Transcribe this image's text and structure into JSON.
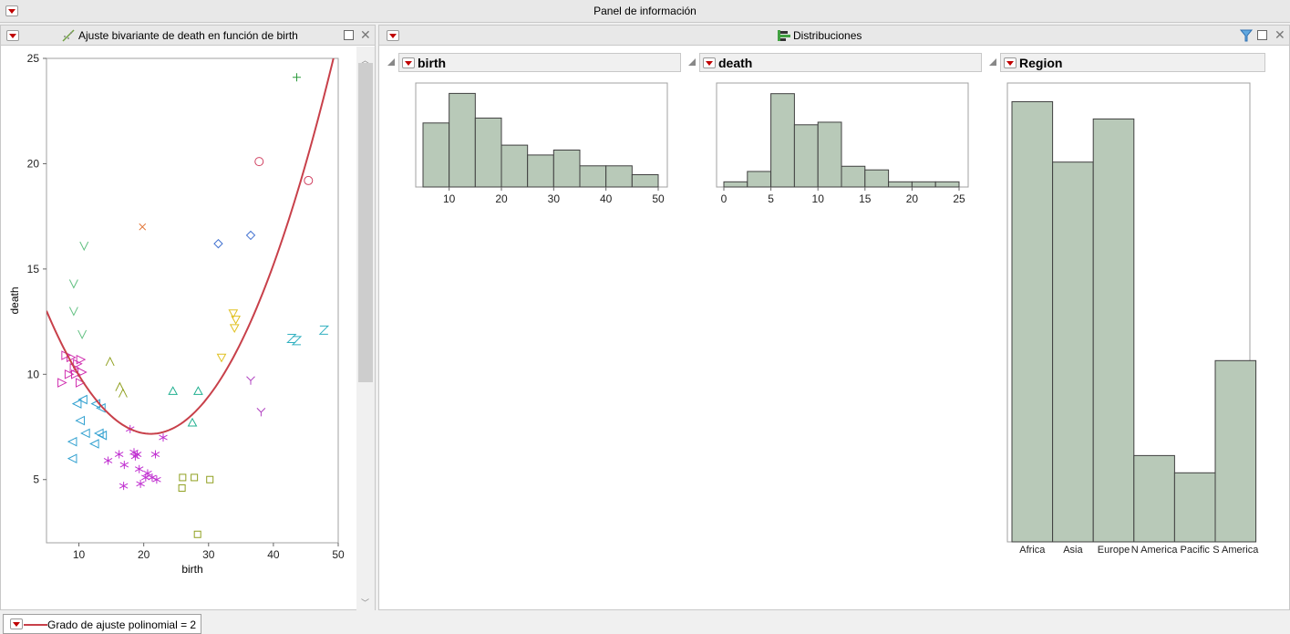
{
  "window": {
    "title": "Panel de información"
  },
  "bivariate": {
    "title": "Ajuste bivariante de death en función de birth",
    "xlabel": "birth",
    "ylabel": "death",
    "fit_label": "Grado de ajuste polinomial = 2"
  },
  "distributions": {
    "title": "Distribuciones",
    "birth": {
      "title": "birth"
    },
    "death": {
      "title": "death"
    },
    "region": {
      "title": "Region"
    }
  },
  "colors": {
    "bar_fill": "#b8c9b8",
    "bar_stroke": "#404040",
    "fit_line": "#c8404a",
    "button_red": "#c00000"
  },
  "chart_data": [
    {
      "type": "scatter",
      "xlabel": "birth",
      "ylabel": "death",
      "xlim": [
        5,
        50
      ],
      "ylim": [
        2,
        25
      ],
      "xticks": [
        10,
        20,
        30,
        40,
        50
      ],
      "yticks": [
        5,
        10,
        15,
        20,
        25
      ],
      "points": [
        {
          "x": 43.6,
          "y": 24.1,
          "m": "+",
          "c": "#2a9a3a"
        },
        {
          "x": 37.8,
          "y": 20.1,
          "m": "o",
          "c": "#d04060"
        },
        {
          "x": 45.4,
          "y": 19.2,
          "m": "o",
          "c": "#d04060"
        },
        {
          "x": 19.8,
          "y": 17.0,
          "m": "x",
          "c": "#e07030"
        },
        {
          "x": 31.5,
          "y": 16.2,
          "m": "d",
          "c": "#4070d0"
        },
        {
          "x": 36.5,
          "y": 16.6,
          "m": "d",
          "c": "#4070d0"
        },
        {
          "x": 10.8,
          "y": 16.1,
          "m": "v",
          "c": "#60c080"
        },
        {
          "x": 9.2,
          "y": 14.3,
          "m": "v",
          "c": "#60c080"
        },
        {
          "x": 9.2,
          "y": 13.0,
          "m": "v",
          "c": "#60c080"
        },
        {
          "x": 10.5,
          "y": 11.9,
          "m": "v",
          "c": "#60c080"
        },
        {
          "x": 33.8,
          "y": 12.9,
          "m": "tv",
          "c": "#e0c020"
        },
        {
          "x": 34.2,
          "y": 12.6,
          "m": "tv",
          "c": "#e0c020"
        },
        {
          "x": 34.0,
          "y": 12.2,
          "m": "tv",
          "c": "#e0c020"
        },
        {
          "x": 32.0,
          "y": 10.8,
          "m": "tv",
          "c": "#e0c020"
        },
        {
          "x": 42.8,
          "y": 11.7,
          "m": "z",
          "c": "#30b0c0"
        },
        {
          "x": 43.6,
          "y": 11.6,
          "m": "z",
          "c": "#30b0c0"
        },
        {
          "x": 47.8,
          "y": 12.1,
          "m": "z",
          "c": "#30b0c0"
        },
        {
          "x": 36.5,
          "y": 9.7,
          "m": "y",
          "c": "#b040c0"
        },
        {
          "x": 38.1,
          "y": 8.2,
          "m": "y",
          "c": "#b040c0"
        },
        {
          "x": 14.8,
          "y": 10.6,
          "m": "^",
          "c": "#90a020"
        },
        {
          "x": 16.3,
          "y": 9.4,
          "m": "^",
          "c": "#90a020"
        },
        {
          "x": 16.8,
          "y": 9.1,
          "m": "^",
          "c": "#90a020"
        },
        {
          "x": 24.5,
          "y": 9.2,
          "m": "t",
          "c": "#20b090"
        },
        {
          "x": 28.4,
          "y": 9.2,
          "m": "t",
          "c": "#20b090"
        },
        {
          "x": 27.5,
          "y": 7.7,
          "m": "t",
          "c": "#20b090"
        },
        {
          "x": 8.0,
          "y": 10.9,
          "m": "r",
          "c": "#d030b0"
        },
        {
          "x": 8.8,
          "y": 10.8,
          "m": "r",
          "c": "#d030b0"
        },
        {
          "x": 9.8,
          "y": 10.5,
          "m": "r",
          "c": "#d030b0"
        },
        {
          "x": 10.3,
          "y": 10.7,
          "m": "r",
          "c": "#d030b0"
        },
        {
          "x": 9.3,
          "y": 10.3,
          "m": "r",
          "c": "#d030b0"
        },
        {
          "x": 8.5,
          "y": 10.0,
          "m": "r",
          "c": "#d030b0"
        },
        {
          "x": 9.5,
          "y": 10.0,
          "m": "r",
          "c": "#d030b0"
        },
        {
          "x": 10.5,
          "y": 10.1,
          "m": "r",
          "c": "#d030b0"
        },
        {
          "x": 7.4,
          "y": 9.6,
          "m": "r",
          "c": "#d030b0"
        },
        {
          "x": 10.2,
          "y": 9.6,
          "m": "r",
          "c": "#d030b0"
        },
        {
          "x": 9.7,
          "y": 8.6,
          "m": "l",
          "c": "#30a0d0"
        },
        {
          "x": 10.6,
          "y": 8.8,
          "m": "l",
          "c": "#30a0d0"
        },
        {
          "x": 12.6,
          "y": 8.6,
          "m": "l",
          "c": "#30a0d0"
        },
        {
          "x": 13.4,
          "y": 8.4,
          "m": "l",
          "c": "#30a0d0"
        },
        {
          "x": 10.2,
          "y": 7.8,
          "m": "l",
          "c": "#30a0d0"
        },
        {
          "x": 11.0,
          "y": 7.2,
          "m": "l",
          "c": "#30a0d0"
        },
        {
          "x": 13.1,
          "y": 7.2,
          "m": "l",
          "c": "#30a0d0"
        },
        {
          "x": 13.6,
          "y": 7.1,
          "m": "l",
          "c": "#30a0d0"
        },
        {
          "x": 9.0,
          "y": 6.8,
          "m": "l",
          "c": "#30a0d0"
        },
        {
          "x": 12.4,
          "y": 6.7,
          "m": "l",
          "c": "#30a0d0"
        },
        {
          "x": 9.0,
          "y": 6.0,
          "m": "l",
          "c": "#30a0d0"
        },
        {
          "x": 17.9,
          "y": 7.4,
          "m": "*",
          "c": "#c030d0"
        },
        {
          "x": 23.0,
          "y": 7.0,
          "m": "*",
          "c": "#c030d0"
        },
        {
          "x": 18.5,
          "y": 6.3,
          "m": "*",
          "c": "#c030d0"
        },
        {
          "x": 19.0,
          "y": 6.2,
          "m": "*",
          "c": "#c030d0"
        },
        {
          "x": 18.7,
          "y": 6.1,
          "m": "*",
          "c": "#c030d0"
        },
        {
          "x": 21.8,
          "y": 6.2,
          "m": "*",
          "c": "#c030d0"
        },
        {
          "x": 16.2,
          "y": 6.2,
          "m": "*",
          "c": "#c030d0"
        },
        {
          "x": 14.5,
          "y": 5.9,
          "m": "*",
          "c": "#c030d0"
        },
        {
          "x": 17.0,
          "y": 5.7,
          "m": "*",
          "c": "#c030d0"
        },
        {
          "x": 19.3,
          "y": 5.5,
          "m": "*",
          "c": "#c030d0"
        },
        {
          "x": 20.6,
          "y": 5.3,
          "m": "*",
          "c": "#c030d0"
        },
        {
          "x": 20.3,
          "y": 5.1,
          "m": "*",
          "c": "#c030d0"
        },
        {
          "x": 21.3,
          "y": 5.1,
          "m": "*",
          "c": "#c030d0"
        },
        {
          "x": 22.0,
          "y": 5.0,
          "m": "*",
          "c": "#c030d0"
        },
        {
          "x": 19.5,
          "y": 4.8,
          "m": "*",
          "c": "#c030d0"
        },
        {
          "x": 16.9,
          "y": 4.7,
          "m": "*",
          "c": "#c030d0"
        },
        {
          "x": 26.0,
          "y": 5.1,
          "m": "s",
          "c": "#90a020"
        },
        {
          "x": 27.8,
          "y": 5.1,
          "m": "s",
          "c": "#90a020"
        },
        {
          "x": 30.2,
          "y": 5.0,
          "m": "s",
          "c": "#90a020"
        },
        {
          "x": 25.9,
          "y": 4.6,
          "m": "s",
          "c": "#90a020"
        },
        {
          "x": 28.3,
          "y": 2.4,
          "m": "s",
          "c": "#90a020"
        }
      ],
      "fit": {
        "type": "polynomial",
        "degree": 2,
        "a": 17.2,
        "b": -0.95,
        "c": 0.0225
      }
    },
    {
      "type": "bar",
      "title": "birth",
      "xlim": [
        5,
        50
      ],
      "xticks": [
        10,
        20,
        30,
        40,
        50
      ],
      "bins": [
        [
          5,
          10
        ],
        [
          10,
          15
        ],
        [
          15,
          20
        ],
        [
          20,
          25
        ],
        [
          25,
          30
        ],
        [
          30,
          35
        ],
        [
          35,
          40
        ],
        [
          40,
          45
        ],
        [
          45,
          50
        ]
      ],
      "values": [
        13,
        19,
        14,
        8.5,
        6.5,
        7.5,
        4.3,
        4.3,
        2.5
      ],
      "ymax": 20
    },
    {
      "type": "bar",
      "title": "death",
      "xlim": [
        0,
        25
      ],
      "xticks": [
        0,
        5,
        10,
        15,
        20,
        25
      ],
      "bins": [
        [
          0,
          2.5
        ],
        [
          2.5,
          5
        ],
        [
          5,
          7.5
        ],
        [
          7.5,
          10
        ],
        [
          10,
          12.5
        ],
        [
          12.5,
          15
        ],
        [
          15,
          17.5
        ],
        [
          17.5,
          20
        ],
        [
          20,
          22.5
        ],
        [
          22.5,
          25
        ]
      ],
      "values": [
        1,
        3,
        18,
        12,
        12.5,
        4,
        3.3,
        1,
        1,
        1
      ],
      "ymax": 19
    },
    {
      "type": "bar",
      "title": "Region",
      "categories": [
        "Africa",
        "Asia",
        "Europe",
        "N America",
        "Pacific",
        "S America"
      ],
      "values": [
        51,
        44,
        49,
        10,
        8,
        21
      ],
      "ymax": 52
    }
  ]
}
